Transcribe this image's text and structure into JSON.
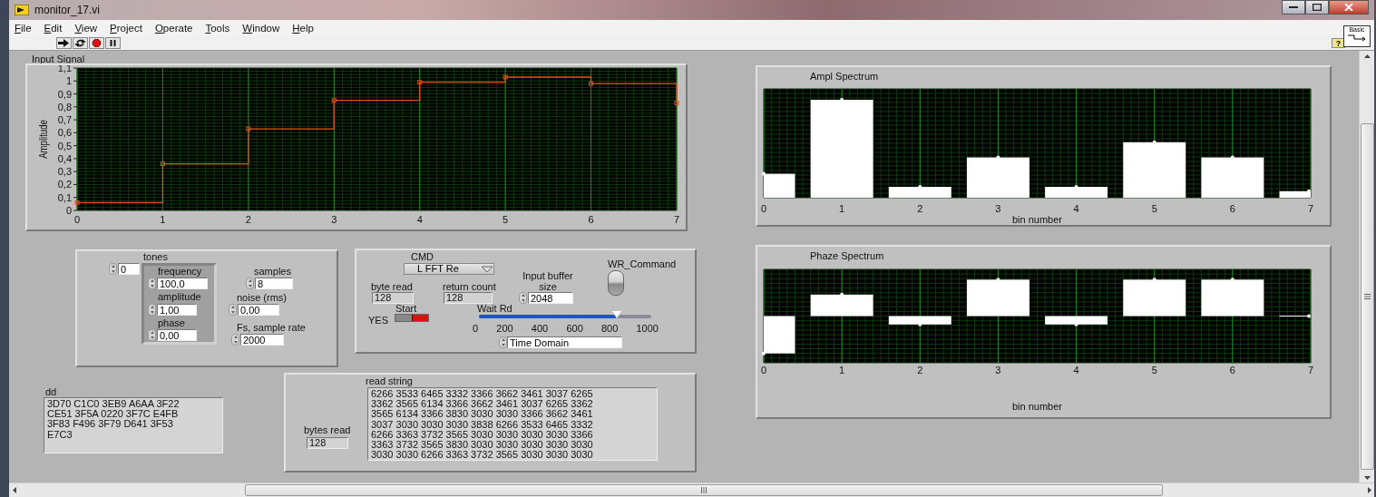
{
  "window": {
    "title": "monitor_17.vi"
  },
  "menu": [
    {
      "label": "File"
    },
    {
      "label": "Edit"
    },
    {
      "label": "View"
    },
    {
      "label": "Project"
    },
    {
      "label": "Operate"
    },
    {
      "label": "Tools"
    },
    {
      "label": "Window"
    },
    {
      "label": "Help"
    }
  ],
  "help_button": "?",
  "palette_button": "Basic",
  "input_signal": {
    "chart_data": {
      "type": "line",
      "title": "Input Signal",
      "ylabel": "Amplitude",
      "x": [
        0,
        1,
        1,
        2,
        2,
        3,
        3,
        4,
        4,
        5,
        5,
        6,
        6,
        7,
        7
      ],
      "series": [
        {
          "color": "#e0501a",
          "marker": "square",
          "values": [
            0.06,
            0.06,
            0.36,
            0.36,
            0.63,
            0.63,
            0.85,
            0.85,
            0.99,
            0.99,
            1.03,
            1.03,
            0.98,
            0.98,
            0.83
          ]
        }
      ],
      "grid": true,
      "xlim": [
        0,
        7
      ],
      "ylim": [
        0,
        1.1
      ],
      "xticks": [
        0,
        1,
        2,
        3,
        4,
        5,
        6,
        7
      ],
      "yticks": [
        {
          "value": 0,
          "label": "0"
        },
        {
          "value": 0.1,
          "label": "0,1"
        },
        {
          "value": 0.2,
          "label": "0,2"
        },
        {
          "value": 0.3,
          "label": "0,3"
        },
        {
          "value": 0.4,
          "label": "0,4"
        },
        {
          "value": 0.5,
          "label": "0,5"
        },
        {
          "value": 0.6,
          "label": "0,6"
        },
        {
          "value": 0.7,
          "label": "0,7"
        },
        {
          "value": 0.8,
          "label": "0,8"
        },
        {
          "value": 0.9,
          "label": "0,9"
        },
        {
          "value": 1,
          "label": "1"
        },
        {
          "value": 1.1,
          "label": "1,1"
        }
      ]
    }
  },
  "ampl_spectrum": {
    "title": "Ampl Spectrum",
    "xticks": [
      "0",
      "1",
      "2",
      "3",
      "4",
      "5",
      "6",
      "7"
    ],
    "xlabel": "bin number"
  },
  "phase_spectrum": {
    "title": "Phaze Spectrum",
    "xticks": [
      "0",
      "1",
      "2",
      "3",
      "4",
      "5",
      "6",
      "7"
    ],
    "xlabel": "bin number"
  },
  "tones": {
    "label": "tones",
    "index": "0",
    "frequency": {
      "label": "frequency",
      "value": "100,0"
    },
    "amplitude": {
      "label": "amplitude",
      "value": "1,00"
    },
    "phase": {
      "label": "phase",
      "value": "0,00"
    }
  },
  "samples": {
    "label": "samples",
    "value": "8"
  },
  "noise": {
    "label": "noise (rms)",
    "value": "0,00"
  },
  "sample_rate": {
    "label": "Fs, sample rate",
    "value": "2000"
  },
  "cmd": {
    "label": "CMD",
    "value": "L FFT Re"
  },
  "byte_read": {
    "label": "byte read",
    "value": "128"
  },
  "return_count": {
    "label": "return count",
    "value": "128"
  },
  "input_buffer_size": {
    "label": "Input buffer size",
    "value": "2048"
  },
  "wr_command": {
    "label": "WR_Command",
    "on": false
  },
  "start": {
    "label": "Start",
    "state_text": "YES",
    "on": true
  },
  "wait_rd": {
    "label": "Wait Rd",
    "level": 0.8,
    "ticks": [
      "0",
      "200",
      "400",
      "600",
      "800",
      "1000"
    ]
  },
  "display_mode": {
    "value": "Time Domain"
  },
  "dd": {
    "label": "dd",
    "value": "3D70 C1C0 3EB9 A6AA 3F22\nCE51 3F5A 0220 3F7C E4FB\n3F83 F496 3F79 D641 3F53\nE7C3"
  },
  "read_string": {
    "label": "read string",
    "value": "6266 3533 6465 3332 3366 3662 3461 3037 6265\n3362 3565 6134 3366 3662 3461 3037 6265 3362\n3565 6134 3366 3830 3030 3030 3366 3662 3461\n3037 3030 3030 3030 3838 6266 3533 6465 3332\n6266 3363 3732 3565 3030 3030 3030 3030 3366\n3363 3732 3565 3830 3030 3030 3030 3030 3030\n3030 3030 6266 3363 3732 3565 3030 3030 3030"
  },
  "bytes_read": {
    "label": "bytes read",
    "value": "128"
  }
}
